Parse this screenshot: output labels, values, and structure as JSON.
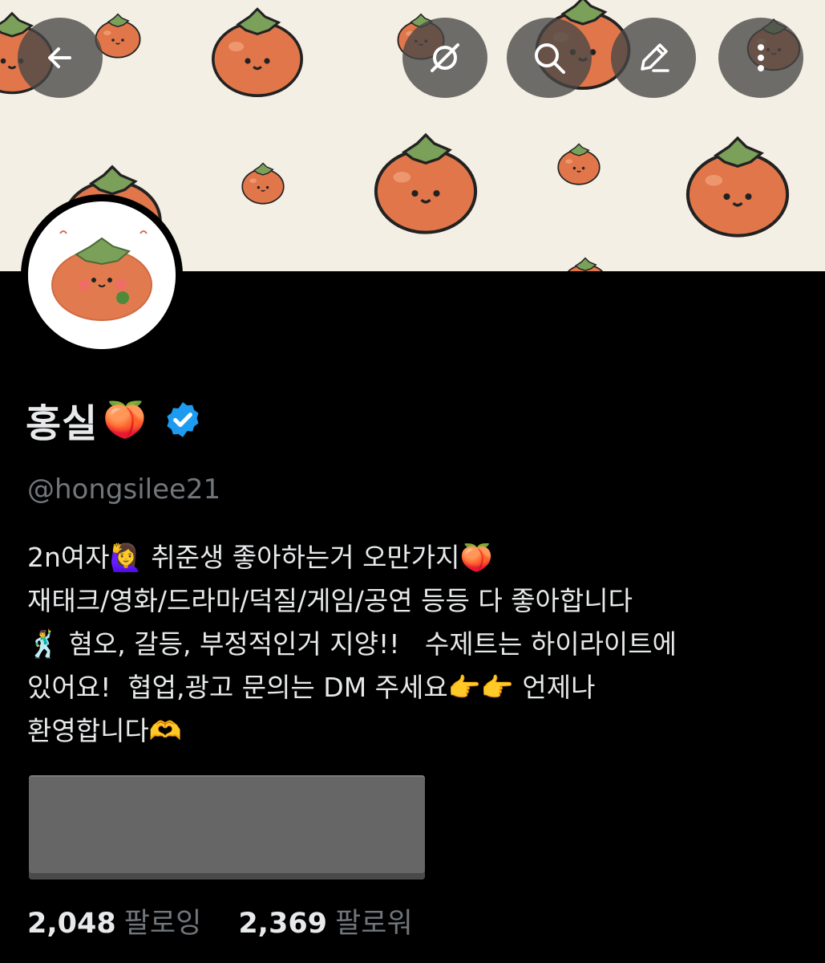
{
  "toolbar": {
    "back_icon": "back-arrow-icon",
    "translate_icon": "grok-slash-icon",
    "search_icon": "search-icon",
    "edit_icon": "edit-pencil-icon",
    "more_icon": "more-vertical-icon"
  },
  "profile": {
    "display_name": "홍실",
    "name_emoji": "🍑",
    "verified": true,
    "handle": "@hongsilee21",
    "bio_lines": [
      "2n여자🙋‍♀️ 취준생 좋아하는거 오만가지🍑",
      "재태크/영화/드라마/덕질/게임/공연 등등 다 좋아합니다",
      "🕺 혐오, 갈등, 부정적인거 지양!!   수제트는 하이라이트에",
      "있어요!  협업,광고 문의는 DM 주세요👉👉 언제나",
      "환영합니다🫶"
    ]
  },
  "stats": {
    "following_count": "2,048",
    "following_label": "팔로잉",
    "followers_count": "2,369",
    "followers_label": "팔로워"
  },
  "colors": {
    "background": "#000000",
    "text_primary": "#e7e9ea",
    "text_secondary": "#71767b",
    "verified_blue": "#1d9bf0",
    "banner_bg": "#f4efe4",
    "persimmon": "#e0764a"
  }
}
